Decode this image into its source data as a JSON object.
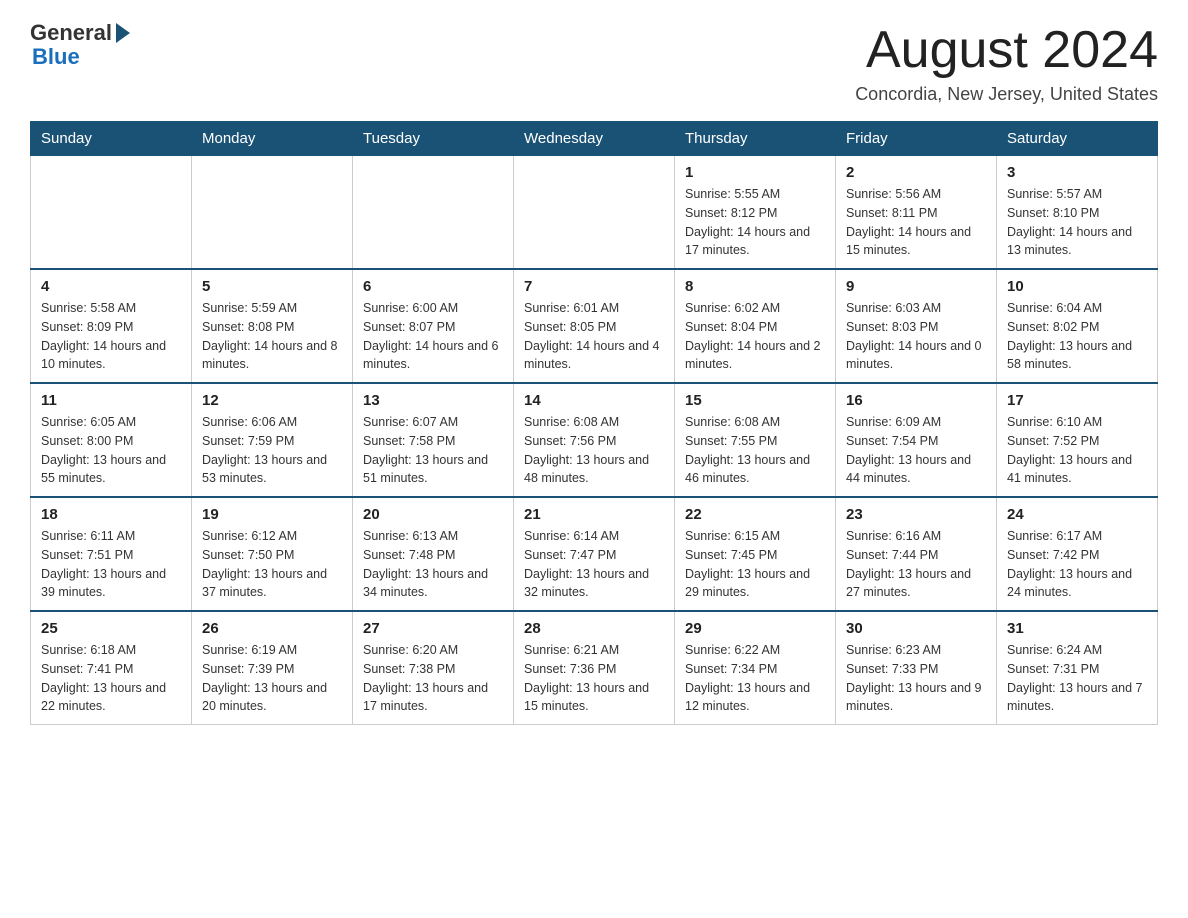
{
  "header": {
    "logo_general": "General",
    "logo_blue": "Blue",
    "month_title": "August 2024",
    "location": "Concordia, New Jersey, United States"
  },
  "days_of_week": [
    "Sunday",
    "Monday",
    "Tuesday",
    "Wednesday",
    "Thursday",
    "Friday",
    "Saturday"
  ],
  "weeks": [
    [
      {
        "day": "",
        "info": ""
      },
      {
        "day": "",
        "info": ""
      },
      {
        "day": "",
        "info": ""
      },
      {
        "day": "",
        "info": ""
      },
      {
        "day": "1",
        "info": "Sunrise: 5:55 AM\nSunset: 8:12 PM\nDaylight: 14 hours and 17 minutes."
      },
      {
        "day": "2",
        "info": "Sunrise: 5:56 AM\nSunset: 8:11 PM\nDaylight: 14 hours and 15 minutes."
      },
      {
        "day": "3",
        "info": "Sunrise: 5:57 AM\nSunset: 8:10 PM\nDaylight: 14 hours and 13 minutes."
      }
    ],
    [
      {
        "day": "4",
        "info": "Sunrise: 5:58 AM\nSunset: 8:09 PM\nDaylight: 14 hours and 10 minutes."
      },
      {
        "day": "5",
        "info": "Sunrise: 5:59 AM\nSunset: 8:08 PM\nDaylight: 14 hours and 8 minutes."
      },
      {
        "day": "6",
        "info": "Sunrise: 6:00 AM\nSunset: 8:07 PM\nDaylight: 14 hours and 6 minutes."
      },
      {
        "day": "7",
        "info": "Sunrise: 6:01 AM\nSunset: 8:05 PM\nDaylight: 14 hours and 4 minutes."
      },
      {
        "day": "8",
        "info": "Sunrise: 6:02 AM\nSunset: 8:04 PM\nDaylight: 14 hours and 2 minutes."
      },
      {
        "day": "9",
        "info": "Sunrise: 6:03 AM\nSunset: 8:03 PM\nDaylight: 14 hours and 0 minutes."
      },
      {
        "day": "10",
        "info": "Sunrise: 6:04 AM\nSunset: 8:02 PM\nDaylight: 13 hours and 58 minutes."
      }
    ],
    [
      {
        "day": "11",
        "info": "Sunrise: 6:05 AM\nSunset: 8:00 PM\nDaylight: 13 hours and 55 minutes."
      },
      {
        "day": "12",
        "info": "Sunrise: 6:06 AM\nSunset: 7:59 PM\nDaylight: 13 hours and 53 minutes."
      },
      {
        "day": "13",
        "info": "Sunrise: 6:07 AM\nSunset: 7:58 PM\nDaylight: 13 hours and 51 minutes."
      },
      {
        "day": "14",
        "info": "Sunrise: 6:08 AM\nSunset: 7:56 PM\nDaylight: 13 hours and 48 minutes."
      },
      {
        "day": "15",
        "info": "Sunrise: 6:08 AM\nSunset: 7:55 PM\nDaylight: 13 hours and 46 minutes."
      },
      {
        "day": "16",
        "info": "Sunrise: 6:09 AM\nSunset: 7:54 PM\nDaylight: 13 hours and 44 minutes."
      },
      {
        "day": "17",
        "info": "Sunrise: 6:10 AM\nSunset: 7:52 PM\nDaylight: 13 hours and 41 minutes."
      }
    ],
    [
      {
        "day": "18",
        "info": "Sunrise: 6:11 AM\nSunset: 7:51 PM\nDaylight: 13 hours and 39 minutes."
      },
      {
        "day": "19",
        "info": "Sunrise: 6:12 AM\nSunset: 7:50 PM\nDaylight: 13 hours and 37 minutes."
      },
      {
        "day": "20",
        "info": "Sunrise: 6:13 AM\nSunset: 7:48 PM\nDaylight: 13 hours and 34 minutes."
      },
      {
        "day": "21",
        "info": "Sunrise: 6:14 AM\nSunset: 7:47 PM\nDaylight: 13 hours and 32 minutes."
      },
      {
        "day": "22",
        "info": "Sunrise: 6:15 AM\nSunset: 7:45 PM\nDaylight: 13 hours and 29 minutes."
      },
      {
        "day": "23",
        "info": "Sunrise: 6:16 AM\nSunset: 7:44 PM\nDaylight: 13 hours and 27 minutes."
      },
      {
        "day": "24",
        "info": "Sunrise: 6:17 AM\nSunset: 7:42 PM\nDaylight: 13 hours and 24 minutes."
      }
    ],
    [
      {
        "day": "25",
        "info": "Sunrise: 6:18 AM\nSunset: 7:41 PM\nDaylight: 13 hours and 22 minutes."
      },
      {
        "day": "26",
        "info": "Sunrise: 6:19 AM\nSunset: 7:39 PM\nDaylight: 13 hours and 20 minutes."
      },
      {
        "day": "27",
        "info": "Sunrise: 6:20 AM\nSunset: 7:38 PM\nDaylight: 13 hours and 17 minutes."
      },
      {
        "day": "28",
        "info": "Sunrise: 6:21 AM\nSunset: 7:36 PM\nDaylight: 13 hours and 15 minutes."
      },
      {
        "day": "29",
        "info": "Sunrise: 6:22 AM\nSunset: 7:34 PM\nDaylight: 13 hours and 12 minutes."
      },
      {
        "day": "30",
        "info": "Sunrise: 6:23 AM\nSunset: 7:33 PM\nDaylight: 13 hours and 9 minutes."
      },
      {
        "day": "31",
        "info": "Sunrise: 6:24 AM\nSunset: 7:31 PM\nDaylight: 13 hours and 7 minutes."
      }
    ]
  ]
}
